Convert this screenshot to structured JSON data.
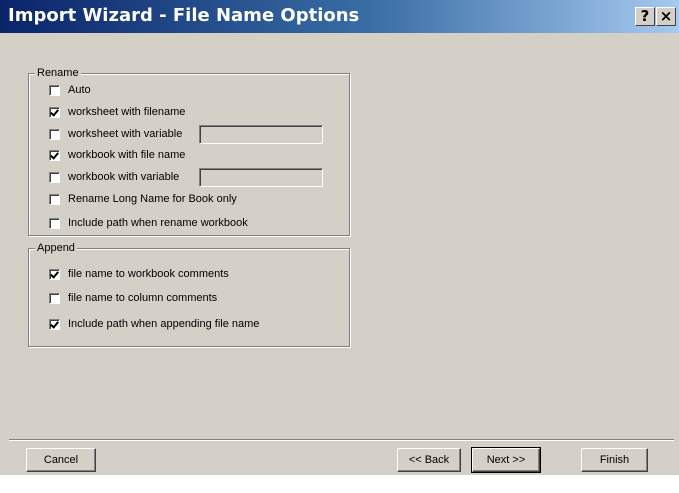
{
  "window": {
    "title": "Import Wizard - File Name Options"
  },
  "titlebar": {
    "help_label": "?",
    "close_label": "×"
  },
  "rename": {
    "legend": "Rename",
    "items": [
      {
        "label": "Auto",
        "checked": false
      },
      {
        "label": "worksheet with filename",
        "checked": true
      },
      {
        "label": "worksheet with variable",
        "checked": false,
        "value": ""
      },
      {
        "label": "workbook with file name",
        "checked": true
      },
      {
        "label": "workbook with variable",
        "checked": false,
        "value": ""
      },
      {
        "label": "Rename Long Name for Book only",
        "checked": false
      },
      {
        "label": "Include path when rename workbook",
        "checked": false
      }
    ]
  },
  "append": {
    "legend": "Append",
    "items": [
      {
        "label": "file name to workbook comments",
        "checked": true
      },
      {
        "label": "file name to column comments",
        "checked": false
      },
      {
        "label": "Include path when appending file name",
        "checked": true
      }
    ]
  },
  "buttons": {
    "cancel": "Cancel",
    "back": "<< Back",
    "next": "Next >>",
    "finish": "Finish"
  }
}
